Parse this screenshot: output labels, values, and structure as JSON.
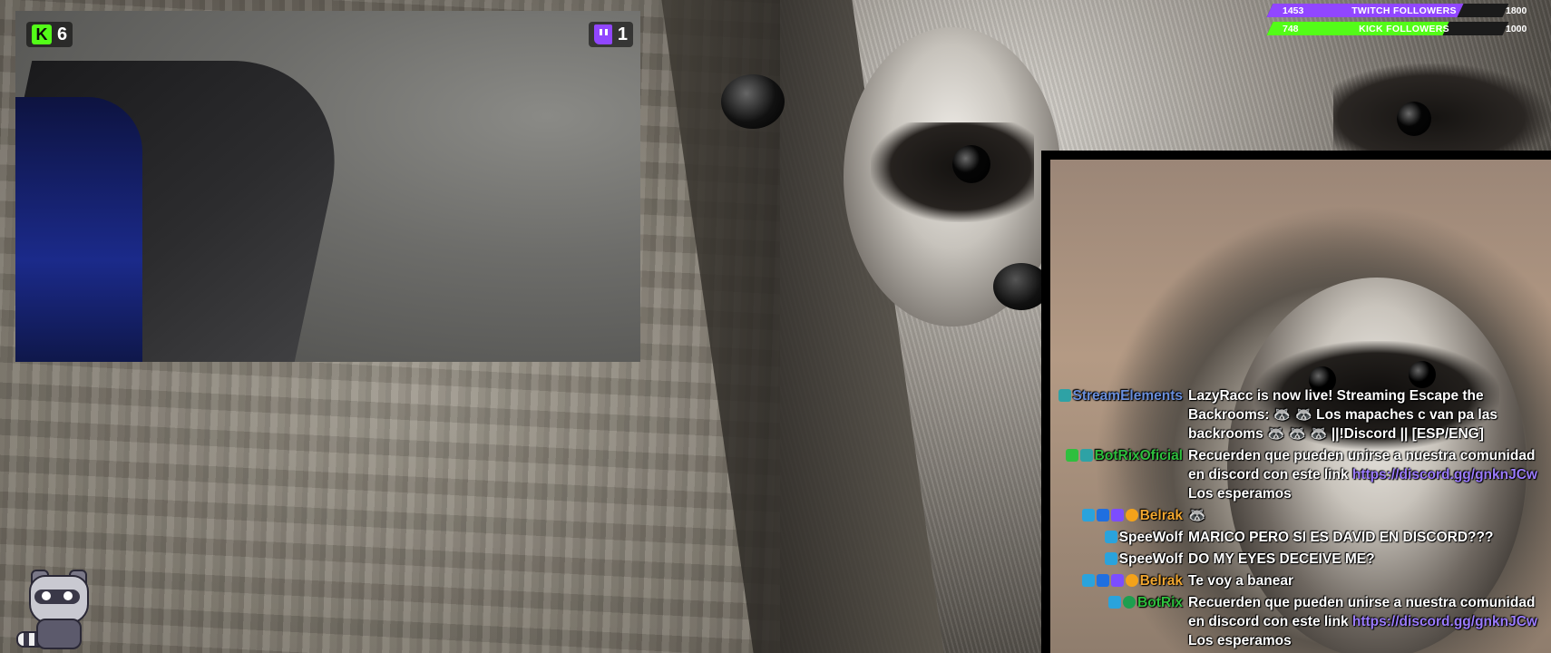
{
  "webcam": {
    "kick_viewers": "6",
    "twitch_viewers": "1",
    "kick_icon": "kick-logo-icon",
    "twitch_icon": "twitch-logo-icon"
  },
  "goals": [
    {
      "label": "TWITCH FOLLOWERS",
      "current": "1453",
      "target": "1800",
      "progress": 0.807,
      "color": "#9146ff"
    },
    {
      "label": "KICK FOLLOWERS",
      "current": "748",
      "target": "1000",
      "progress": 0.748,
      "color": "#53fc18"
    }
  ],
  "chat": {
    "messages": [
      {
        "user": "StreamElements",
        "color": "#6a8fdc",
        "badges": [
          "b-bot"
        ],
        "text": "LazyRacc is now live! Streaming Escape the Backrooms: 🦝 🦝 Los mapaches c van pa las backrooms 🦝 🦝 🦝 ||!Discord || [ESP/ENG]",
        "link": "",
        "after": ""
      },
      {
        "user": "BotRixOficial",
        "color": "#2fbf3e",
        "badges": [
          "b-green",
          "b-bot"
        ],
        "text": "Recuerden que pueden unirse a nuestra comunidad en discord con este link ",
        "link": "https://discord.gg/gnknJCw",
        "after": " Los esperamos"
      },
      {
        "user": "Belrak",
        "color": "#f0a630",
        "badges": [
          "b-mod",
          "b-vip",
          "b-sub",
          "b-bits"
        ],
        "text": "🦝",
        "link": "",
        "after": ""
      },
      {
        "user": "SpeeWolf",
        "color": "#ffffff",
        "badges": [
          "b-mod"
        ],
        "text": "MARICO PERO SI ES DAVID EN DISCORD???",
        "link": "",
        "after": ""
      },
      {
        "user": "SpeeWolf",
        "color": "#ffffff",
        "badges": [
          "b-mod"
        ],
        "text": "DO MY EYES DECEIVE ME?",
        "link": "",
        "after": ""
      },
      {
        "user": "Belrak",
        "color": "#f0a630",
        "badges": [
          "b-mod",
          "b-vip",
          "b-sub",
          "b-bits"
        ],
        "text": "Te voy a banear",
        "link": "",
        "after": ""
      },
      {
        "user": "BotRix",
        "color": "#2fbf3e",
        "badges": [
          "b-mod",
          "b-verified"
        ],
        "text": "Recuerden que pueden unirse a nuestra comunidad en discord con este link ",
        "link": "https://discord.gg/gnknJCw",
        "after": " Los esperamos"
      }
    ]
  },
  "mascot": {
    "icon": "raccoon-mascot-icon"
  }
}
